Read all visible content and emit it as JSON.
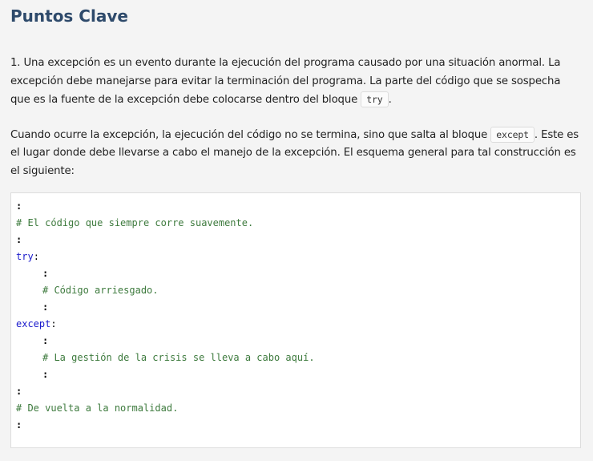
{
  "heading": "Puntos Clave",
  "para1": {
    "text_before": "1. Una excepción es un evento durante la ejecución del programa causado por una situación anormal. La excepción debe manejarse para evitar la terminación del programa. La parte del código que se sospecha que es la fuente de la excepción debe colocarse dentro del bloque ",
    "code": "try",
    "text_after": "."
  },
  "para2": {
    "text_before": "Cuando ocurre la excepción, la ejecución del código no se termina, sino que salta al bloque ",
    "code": "except",
    "text_after": ". Este es el lugar donde debe llevarse a cabo el manejo de la excepción. El esquema general para tal construcción es el siguiente:"
  },
  "code_block": {
    "lines": [
      {
        "type": "colon",
        "indent": false,
        "text": ":"
      },
      {
        "type": "comment",
        "indent": false,
        "text": "# El código que siempre corre suavemente."
      },
      {
        "type": "colon",
        "indent": false,
        "text": ":"
      },
      {
        "type": "keyword",
        "indent": false,
        "text": "try",
        "suffix": ":"
      },
      {
        "type": "colon",
        "indent": true,
        "text": ":"
      },
      {
        "type": "comment",
        "indent": true,
        "text": "# Código arriesgado."
      },
      {
        "type": "colon",
        "indent": true,
        "text": ":"
      },
      {
        "type": "keyword",
        "indent": false,
        "text": "except",
        "suffix": ":"
      },
      {
        "type": "colon",
        "indent": true,
        "text": ":"
      },
      {
        "type": "comment",
        "indent": true,
        "text": "# La gestión de la crisis se lleva a cabo aquí."
      },
      {
        "type": "colon",
        "indent": true,
        "text": ":"
      },
      {
        "type": "colon",
        "indent": false,
        "text": ":"
      },
      {
        "type": "comment",
        "indent": false,
        "text": "# De vuelta a la normalidad."
      },
      {
        "type": "colon",
        "indent": false,
        "text": ":"
      }
    ]
  },
  "colors": {
    "heading": "#2e4a6b",
    "comment": "#3d7a3d",
    "keyword": "#1a1acc",
    "background": "#f4f4f4"
  }
}
